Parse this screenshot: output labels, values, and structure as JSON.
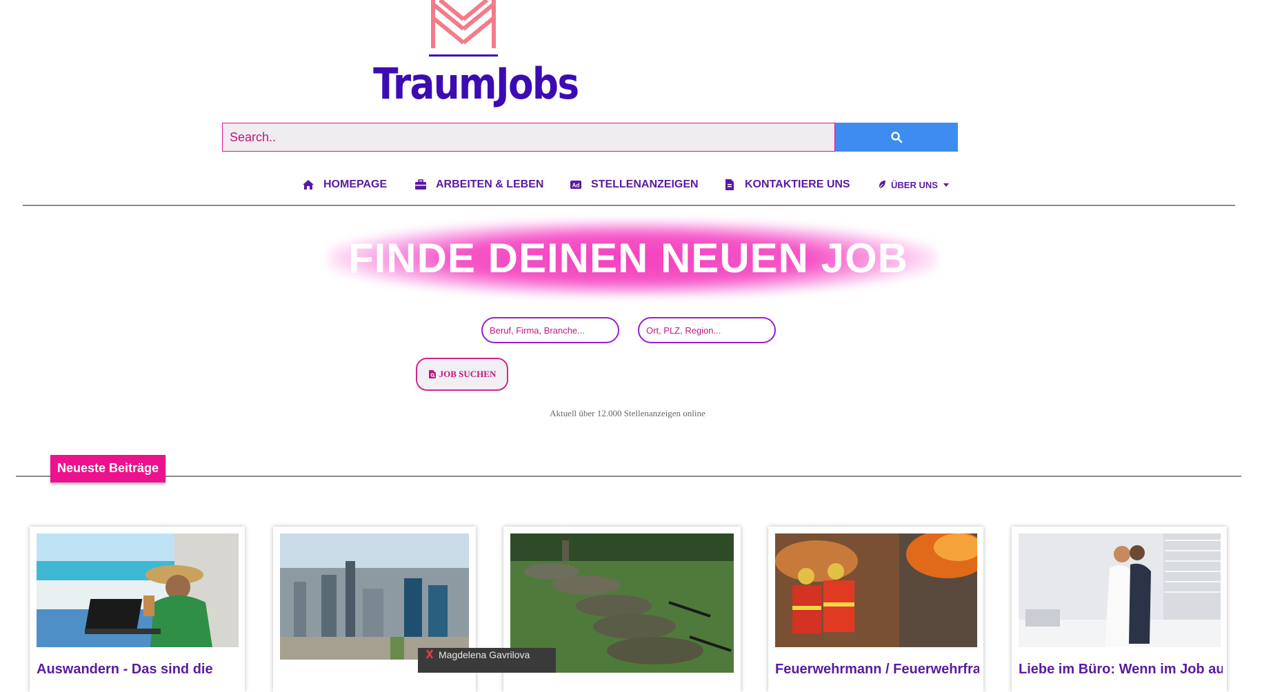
{
  "brand": {
    "name": "TraumJobs",
    "logo_color": "#3d0bb3",
    "mark_color": "#f47b8a"
  },
  "search": {
    "placeholder": "Search..",
    "button_icon": "search-icon",
    "accent": "#3e8cf0"
  },
  "nav": {
    "items": [
      {
        "label": "HOMEPAGE",
        "icon": "home-icon"
      },
      {
        "label": "ARBEITEN & LEBEN",
        "icon": "briefcase-icon"
      },
      {
        "label": "STELLENANZEIGEN",
        "icon": "ad-icon"
      },
      {
        "label": "KONTAKTIERE UNS",
        "icon": "file-icon"
      },
      {
        "label": "ÜBER UNS",
        "icon": "leaf-icon"
      }
    ]
  },
  "hero": {
    "title": "FINDE DEINEN NEUEN JOB",
    "glow_color": "#f436bc",
    "job_field_placeholder": "Beruf, Firma, Branche...",
    "location_field_placeholder": "Ort, PLZ, Region...",
    "search_button_label": "JOB SUCHEN",
    "stat_text": "Aktuell über 12.000 Stellenanzeigen online"
  },
  "section": {
    "title": "Neueste Beiträge",
    "tag_color": "#ec128d"
  },
  "posts": [
    {
      "title": "Auswandern - Das sind die"
    },
    {
      "title": ""
    },
    {
      "title": ""
    },
    {
      "title": "Feuerwehrmann / Feuerwehrfrau"
    },
    {
      "title": "Liebe im Büro: Wenn im Job aus"
    }
  ],
  "image_credit": {
    "name": "Magdelena Gavrilova"
  }
}
